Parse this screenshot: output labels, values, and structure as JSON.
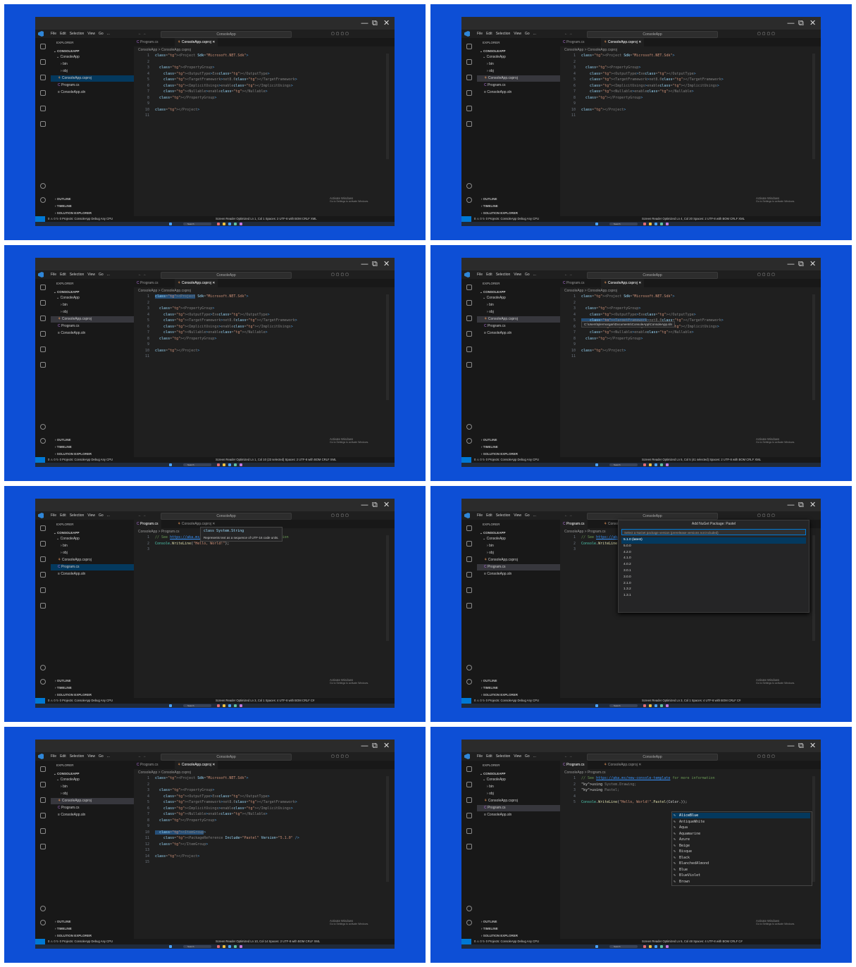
{
  "common": {
    "menus": [
      "File",
      "Edit",
      "Selection",
      "View",
      "Go",
      "..."
    ],
    "command_center": "ConsoleApp",
    "explorer_title": "EXPLORER",
    "project_root": "CONSOLEAPP",
    "breadcrumb_proj": "ConsoleApp > ConsoleApp.csproj",
    "breadcrumb_prog": "ConsoleApp > Program.cs",
    "sections": [
      "OUTLINE",
      "TIMELINE",
      "SOLUTION EXPLORER"
    ],
    "activate_1": "Activate Windows",
    "activate_2": "Go to Settings to activate Windows.",
    "tab_program": "Program.cs",
    "tab_csproj": "ConsoleApp.csproj",
    "search_label": "Search",
    "status_items": "0 ⚠ 0   ↻ 0   Projects: ConsoleApp   Debug Any CPU"
  },
  "frames": [
    {
      "tree": [
        "ConsoleApp",
        "bin",
        "obj",
        "ConsoleApp.csproj",
        "Program.cs",
        "ConsoleApp.sln"
      ],
      "selected": 3,
      "active_tab": "csproj",
      "status": "Screen Reader Optimized   Ln 1, Col 1   Spaces: 2   UTF-8 with BOM   CRLF   XML"
    },
    {
      "tree": [
        "ConsoleApp",
        "bin",
        "obj",
        "ConsoleApp.csproj",
        "Program.cs",
        "ConsoleApp.sln"
      ],
      "selected": 3,
      "active_tab": "csproj",
      "status": "Screen Reader Optimized   Ln 4, Col 20   Spaces: 2   UTF-8 with BOM   CRLF   XML"
    },
    {
      "tree": [
        "ConsoleApp",
        "bin",
        "obj",
        "ConsoleApp.csproj",
        "Program.cs",
        "ConsoleApp.sln"
      ],
      "selected": 3,
      "active_tab": "csproj",
      "status": "Screen Reader Optimized   Ln 1, Col 10 (23 selected)   Spaces: 2   UTF-8 with BOM   CRLF   XML"
    },
    {
      "tree": [
        "ConsoleApp",
        "bin",
        "obj",
        "ConsoleApp.csproj",
        "Program.cs",
        "ConsoleApp.sln"
      ],
      "selected": 3,
      "active_tab": "csproj",
      "status": "Screen Reader Optimized   Ln 5, Col 5 (41 selected)   Spaces: 2   UTF-8 with BOM   CRLF   XML",
      "path_tooltip": "C:\\Users\\tylermorgan\\Documents\\ConsoleApp\\ConsoleApp.sln"
    },
    {
      "tree": [
        "ConsoleApp",
        "bin",
        "obj",
        "ConsoleApp.csproj",
        "Program.cs",
        "ConsoleApp.sln"
      ],
      "selected": 4,
      "active_tab": "program",
      "status": "Screen Reader Optimized   Ln 3, Col 1   Spaces: 4   UTF-8 with BOM   CRLF   C#",
      "hover_title": "class System.String",
      "hover_desc": "Represents text as a sequence of UTF-16 code units."
    },
    {
      "tree": [
        "ConsoleApp",
        "bin",
        "obj",
        "ConsoleApp.csproj",
        "Program.cs",
        "ConsoleApp.sln"
      ],
      "selected": 4,
      "active_tab": "program",
      "status": "Screen Reader Optimized   Ln 3, Col 1   Spaces: 4   UTF-8 with BOM   CRLF   C#",
      "nuget_title": "Add NuGet Package: Pastel",
      "nuget_placeholder": "Select a NuGet package version (prerelease versions not included)",
      "nuget_versions": [
        "5.1.0 (latest)",
        "5.0.0",
        "4.2.0",
        "4.1.0",
        "4.0.2",
        "3.0.1",
        "3.0.0",
        "2.1.0",
        "1.3.2",
        "1.3.1"
      ]
    },
    {
      "tree": [
        "ConsoleApp",
        "bin",
        "obj",
        "ConsoleApp.csproj",
        "Program.cs",
        "ConsoleApp.sln"
      ],
      "selected": 3,
      "active_tab": "csproj",
      "status": "Screen Reader Optimized   Ln 10, Col 14   Spaces: 2   UTF-8 with BOM   CRLF   XML"
    },
    {
      "tree": [
        "ConsoleApp",
        "bin",
        "obj",
        "ConsoleApp.csproj",
        "Program.cs",
        "ConsoleApp.sln"
      ],
      "selected": 4,
      "active_tab": "program",
      "status": "Screen Reader Optimized   Ln 5, Col 48   Spaces: 4   UTF-8 with BOM   CRLF   C#",
      "suggestions": [
        "AliceBlue",
        "AntiqueWhite",
        "Aqua",
        "Aquamarine",
        "Azure",
        "Beige",
        "Bisque",
        "Black",
        "BlanchedAlmond",
        "Blue",
        "BlueViolet",
        "Brown"
      ]
    }
  ],
  "code_csproj": [
    "<Project Sdk=\"Microsoft.NET.Sdk\">",
    "",
    "  <PropertyGroup>",
    "    <OutputType>Exe</OutputType>",
    "    <TargetFramework>net8.0</TargetFramework>",
    "    <ImplicitUsings>enable</ImplicitUsings>",
    "    <Nullable>enable</Nullable>",
    "  </PropertyGroup>",
    "",
    "</Project>",
    ""
  ],
  "code_csproj_pkg": [
    "<Project Sdk=\"Microsoft.NET.Sdk\">",
    "",
    "  <PropertyGroup>",
    "    <OutputType>Exe</OutputType>",
    "    <TargetFramework>net8.0</TargetFramework>",
    "    <ImplicitUsings>enable</ImplicitUsings>",
    "    <Nullable>enable</Nullable>",
    "  </PropertyGroup>",
    "",
    "  <ItemGroup>",
    "    <PackageReference Include=\"Pastel\" Version=\"5.1.0\" />",
    "  </ItemGroup>",
    "",
    "</Project>",
    ""
  ],
  "code_program": [
    "// See https://aka.ms/new-console-template for more information",
    "Console.WriteLine(\"Hello, World!\");",
    ""
  ],
  "code_program_pastel": [
    "// See https://aka.ms/new-console-template for more information",
    "using System.Drawing;",
    "using Pastel;",
    "",
    "Console.WriteLine(\"Hello, World!\".Pastel(Color.));"
  ],
  "colors": {
    "background": "#0d4fd6",
    "accent": "#0078d4"
  }
}
